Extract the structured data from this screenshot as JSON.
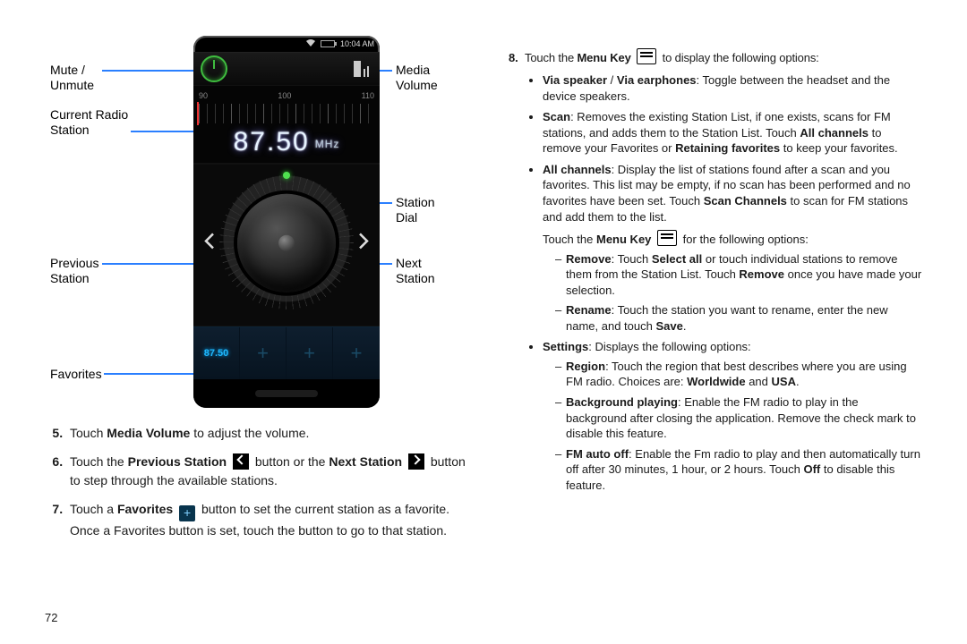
{
  "page_number": "72",
  "callouts": {
    "mute": "Mute /",
    "unmute": "Unmute",
    "current_radio": "Current Radio",
    "station": "Station",
    "previous": "Previous",
    "previous_station": "Station",
    "favorites": "Favorites",
    "media": "Media",
    "volume": "Volume",
    "station_dial_1": "Station",
    "station_dial_2": "Dial",
    "next": "Next",
    "next_station": "Station"
  },
  "phone": {
    "time": "10:04 AM",
    "scale_marks": [
      "90",
      "100",
      "110"
    ],
    "frequency": "87.50",
    "mhz_label": "MHz",
    "preset_value": "87.50"
  },
  "left_steps": {
    "s5": {
      "pre": "Touch ",
      "b": "Media Volume",
      "post": " to adjust the volume."
    },
    "s6": {
      "pre": "Touch the ",
      "b1": "Previous Station",
      "mid": " button or the ",
      "b2": "Next Station",
      "post": " button to step through the available stations."
    },
    "s7": {
      "pre": "Touch a ",
      "b": "Favorites",
      "post": " button to set the current station as a favorite. Once a Favorites button is set, touch the button to go to that station."
    }
  },
  "right": {
    "s8": {
      "pre": "Touch the ",
      "b": "Menu Key",
      "post": " to display the following options:"
    },
    "via": {
      "b1": "Via speaker",
      "sep": " / ",
      "b2": "Via earphones",
      "post": ": Toggle between the headset and the device speakers."
    },
    "scan": {
      "b": "Scan",
      "t1": ": Removes the existing Station List, if one exists, scans for FM stations, and adds them to the Station List. Touch ",
      "b2": "All channels",
      "t2": " to remove your Favorites or ",
      "b3": "Retaining favorites",
      "t3": " to keep your favorites."
    },
    "all": {
      "b": "All channels",
      "t1": ": Display the list of stations found after a scan and you favorites. This list may be empty, if no scan has been performed and no favorites have been set. Touch ",
      "b2": "Scan Channels",
      "t2": " to scan for FM stations and add them to the list."
    },
    "menu2": {
      "pre": "Touch the ",
      "b": "Menu Key",
      "post": " for the following options:"
    },
    "remove": {
      "b": "Remove",
      "t1": ": Touch ",
      "b2": "Select all",
      "t2": " or touch individual stations to remove them from the Station List. Touch ",
      "b3": "Remove",
      "t3": " once you have made your selection."
    },
    "rename": {
      "b": "Rename",
      "t1": ": Touch the station you want to rename, enter the new name, and touch ",
      "b2": "Save",
      "t2": "."
    },
    "settings": {
      "b": "Settings",
      "post": ": Displays the following options:"
    },
    "region": {
      "b": "Region",
      "t1": ": Touch the region that best describes where you are using FM radio. Choices are: ",
      "b2": "Worldwide",
      "t2": " and ",
      "b3": "USA",
      "t3": "."
    },
    "bg": {
      "b": "Background playing",
      "post": ": Enable the FM radio to play in the background after closing the application. Remove the check mark to disable this feature."
    },
    "auto": {
      "b": "FM auto off",
      "t1": ": Enable the Fm radio to play and then automatically turn off after 30 minutes, 1 hour, or 2 hours. Touch ",
      "b2": "Off",
      "t2": " to disable this feature."
    }
  }
}
